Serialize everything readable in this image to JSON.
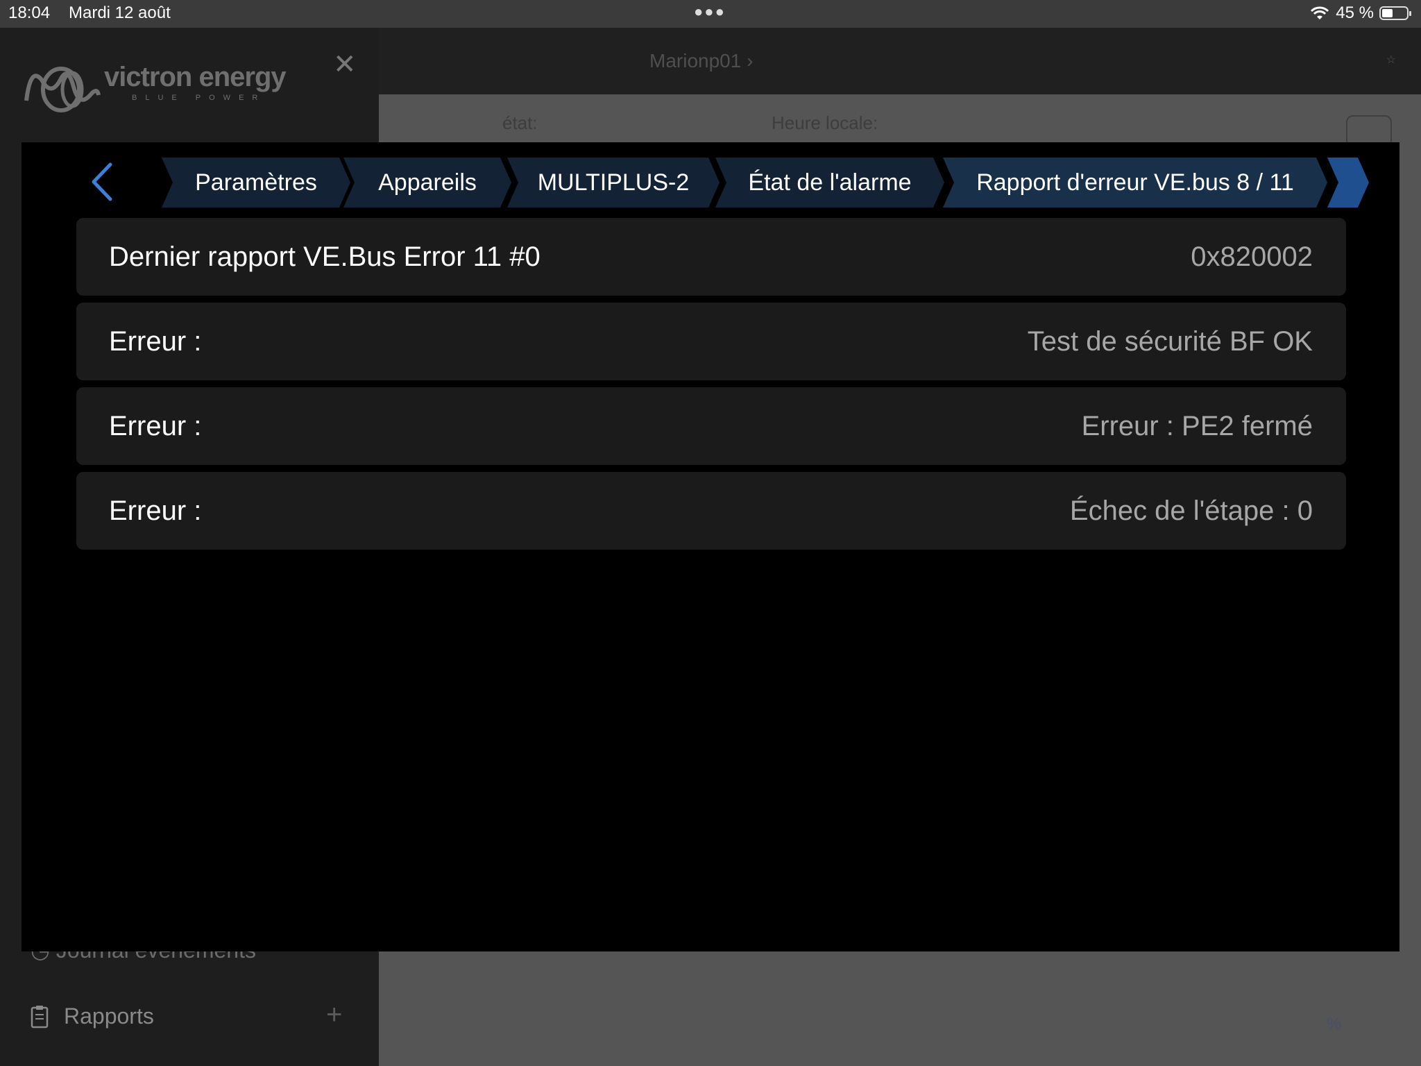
{
  "status_bar": {
    "time": "18:04",
    "date": "Mardi 12 août",
    "battery": "45 %",
    "battery_level_percent": 45
  },
  "background": {
    "logo_text": "victron energy",
    "logo_tagline": "BLUE POWER",
    "site_breadcrumb": "Marionp01",
    "state_label": "état:",
    "local_time_label": "Heure locale:",
    "percent_symbol": "%",
    "sidebar_items": [
      {
        "label": "Journal événements",
        "icon": "clock-icon"
      },
      {
        "label": "Rapports",
        "icon": "clipboard-icon"
      }
    ]
  },
  "modal": {
    "breadcrumbs": [
      {
        "label": "Paramètres"
      },
      {
        "label": "Appareils"
      },
      {
        "label": "MULTIPLUS-2"
      },
      {
        "label": "État de l'alarme"
      },
      {
        "label": "Rapport d'erreur VE.bus 8 / 11"
      }
    ],
    "rows": [
      {
        "label": "Dernier rapport VE.Bus Error 11 #0",
        "value": "0x820002"
      },
      {
        "label": "Erreur :",
        "value": "Test de sécurité BF OK"
      },
      {
        "label": "Erreur :",
        "value": "Erreur : PE2 fermé"
      },
      {
        "label": "Erreur :",
        "value": "Échec de l'étape : 0"
      }
    ]
  },
  "colors": {
    "accent": "#2d6fc4",
    "chip_bg": "#142235",
    "row_bg": "#1b1b1c",
    "value_text": "#a7a7a7"
  }
}
